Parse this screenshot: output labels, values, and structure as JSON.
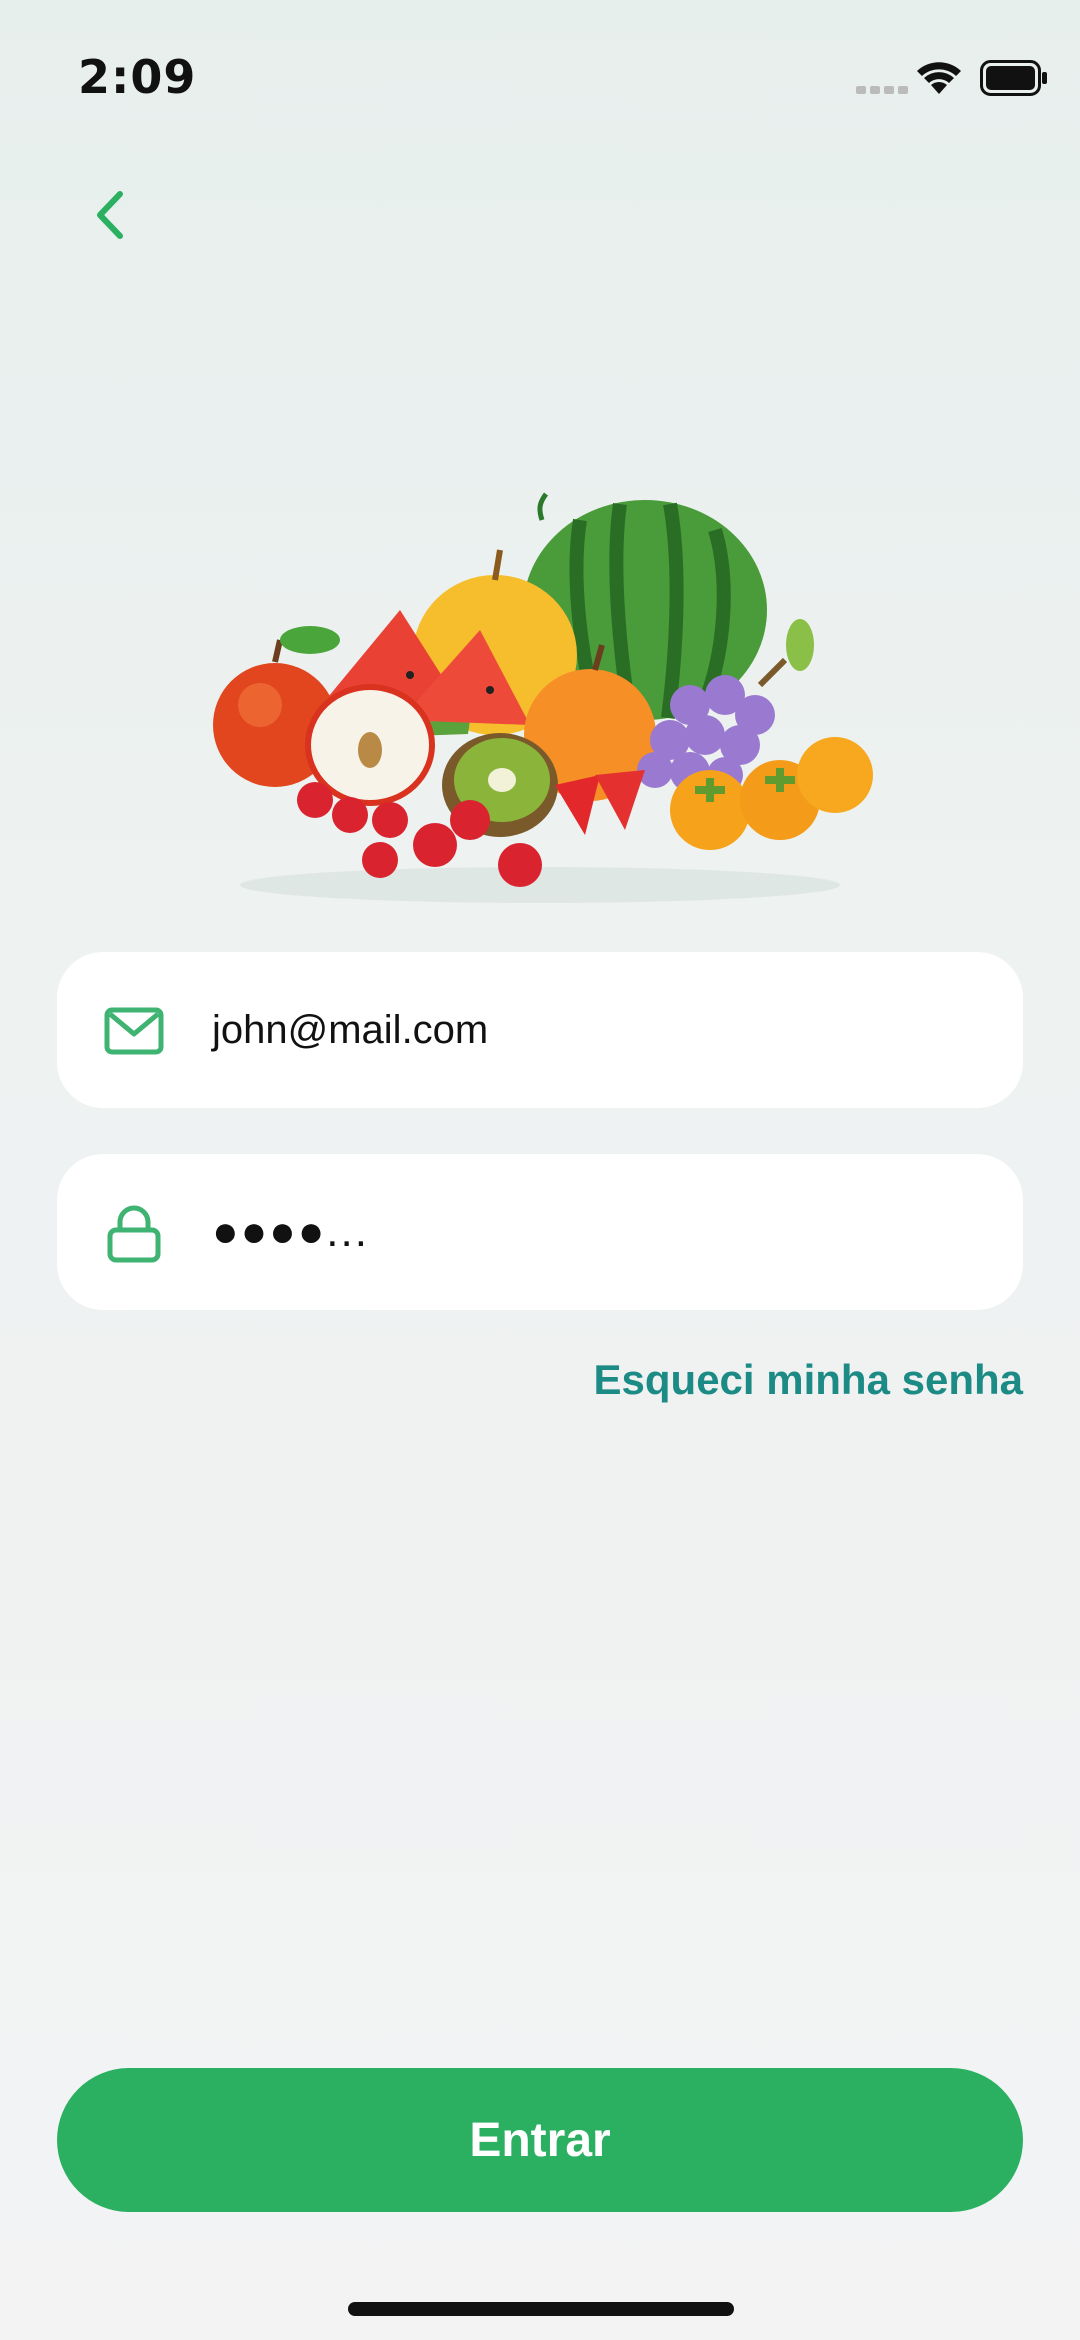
{
  "status_bar": {
    "time": "2:09",
    "icons": [
      "signal-icon",
      "wifi-icon",
      "battery-icon"
    ]
  },
  "nav": {
    "back_icon": "chevron-left-icon"
  },
  "form": {
    "email": {
      "icon": "mail-icon",
      "value": "john@mail.com"
    },
    "password": {
      "icon": "lock-icon",
      "value": "●●●●..."
    },
    "forgot_label": "Esqueci minha senha",
    "submit_label": "Entrar"
  },
  "colors": {
    "accent": "#2bb062",
    "link": "#1c8a85",
    "icon": "#3fb371"
  }
}
